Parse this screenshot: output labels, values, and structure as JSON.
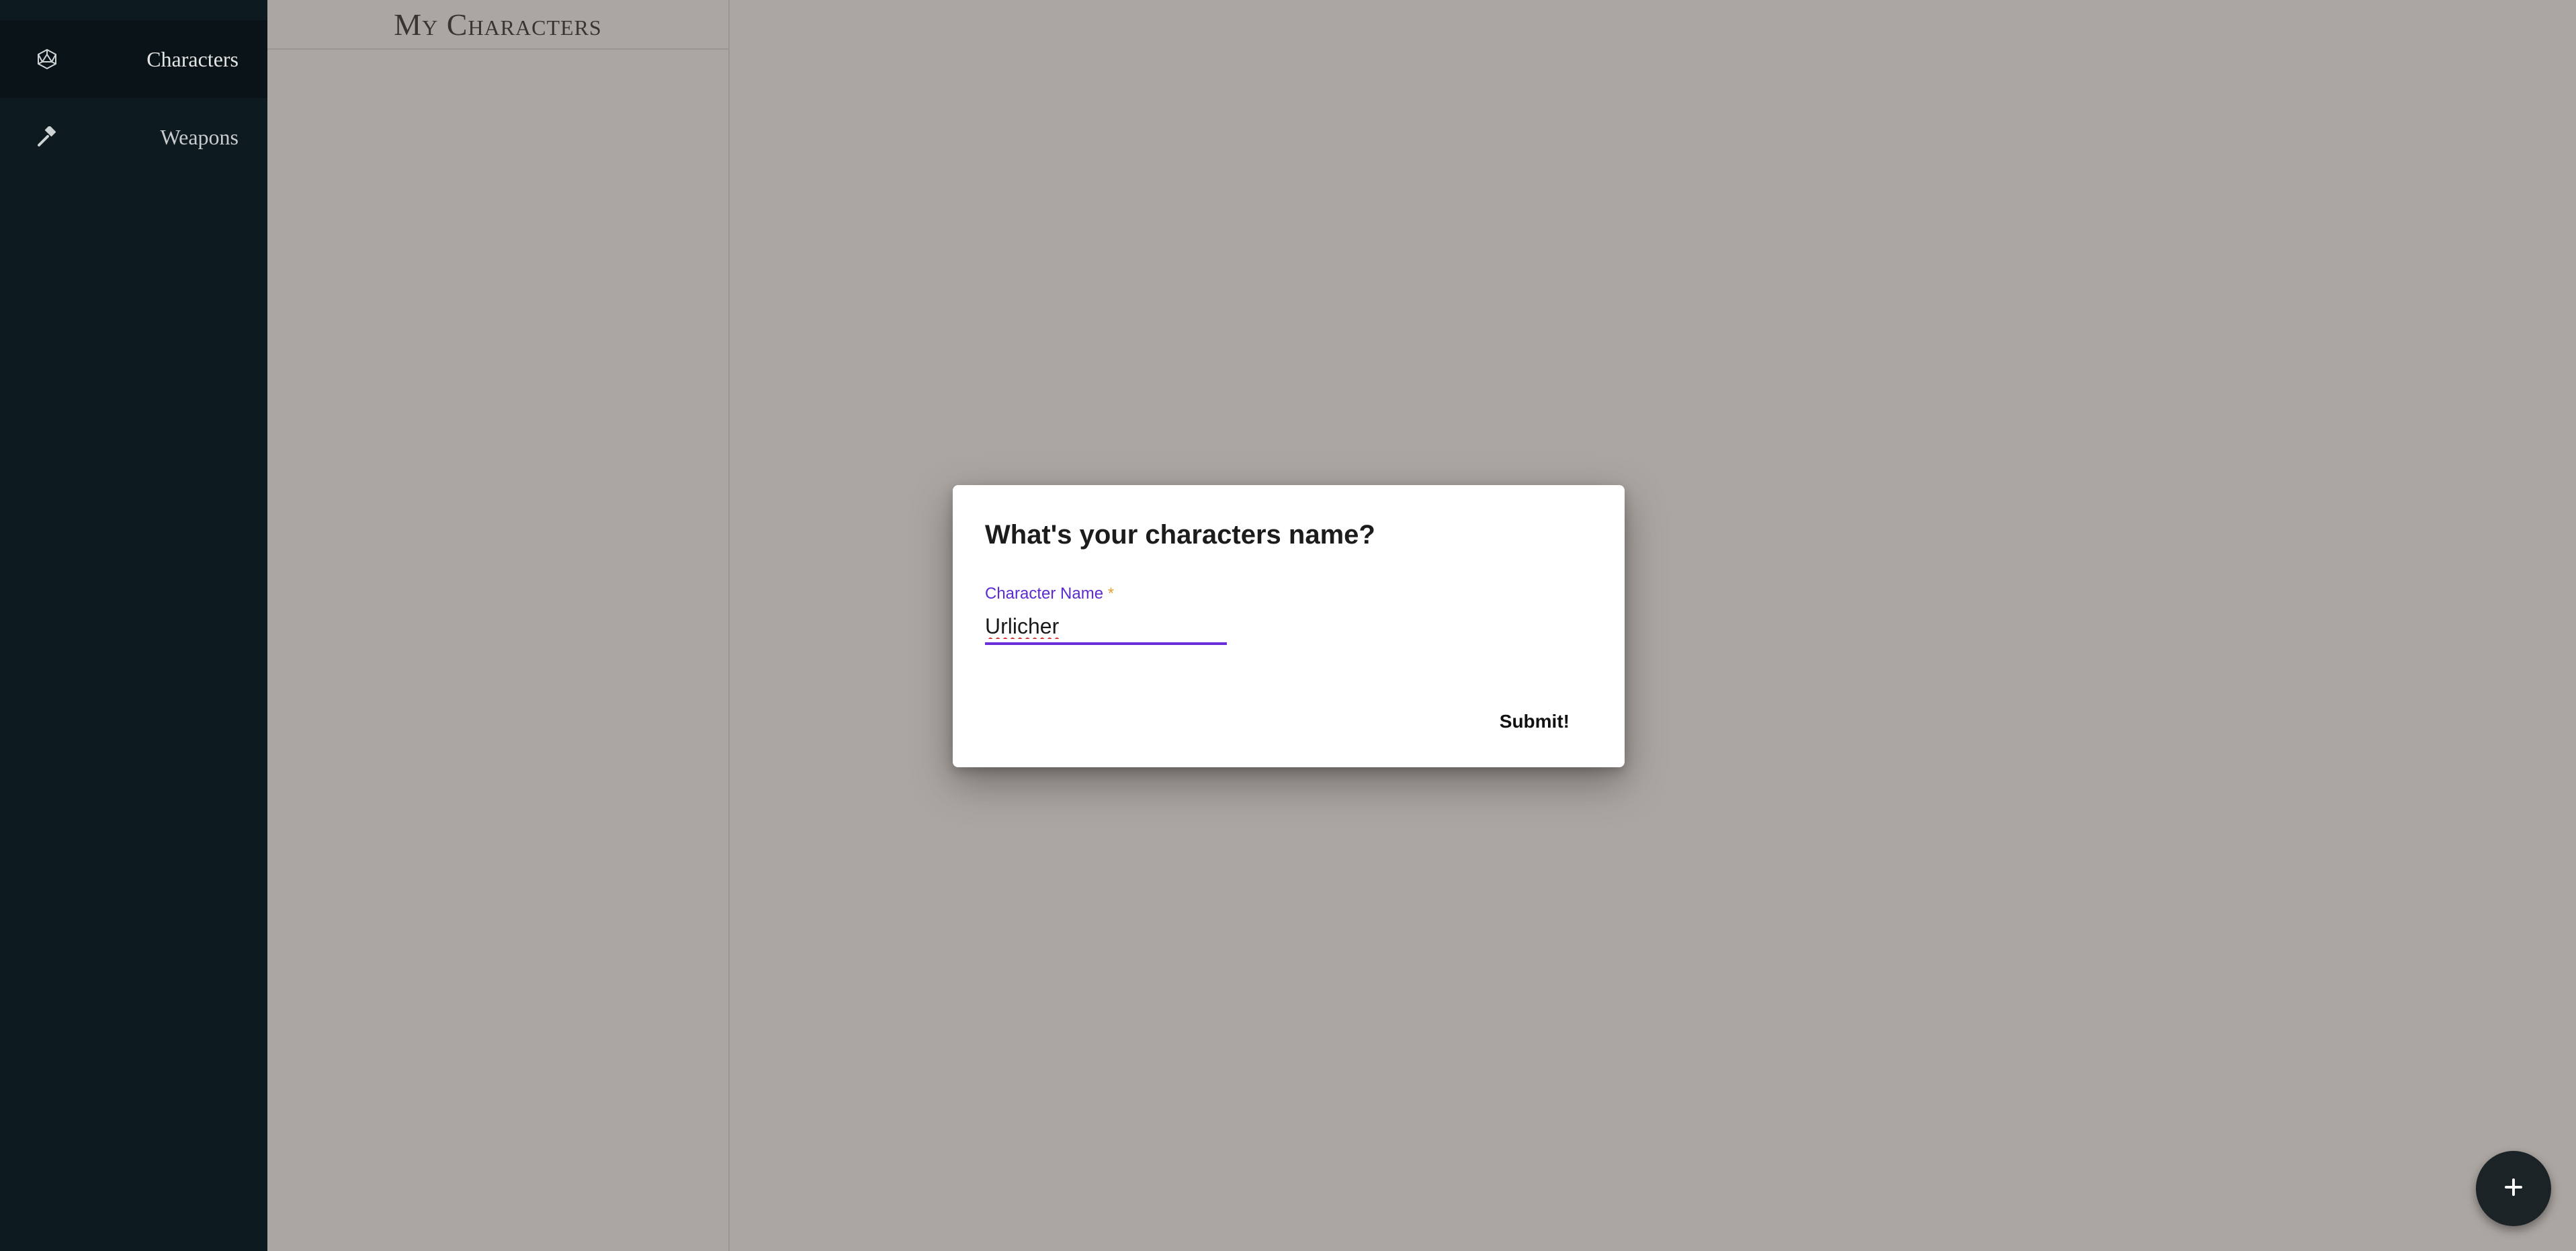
{
  "sidebar": {
    "items": [
      {
        "label": "Characters",
        "icon": "d20-icon",
        "active": true
      },
      {
        "label": "Weapons",
        "icon": "hammer-icon",
        "active": false
      }
    ]
  },
  "list_panel": {
    "title": "My Characters"
  },
  "dialog": {
    "title": "What's your characters name?",
    "field_label": "Character Name",
    "required_mark": "*",
    "field_value": "Urlicher",
    "submit_label": "Submit!"
  },
  "fab": {
    "icon": "plus-icon"
  },
  "colors": {
    "sidebar_bg": "#0d1a1f",
    "accent": "#6a2fd9",
    "required": "#e6a23c",
    "fab_bg": "#1b2327"
  }
}
